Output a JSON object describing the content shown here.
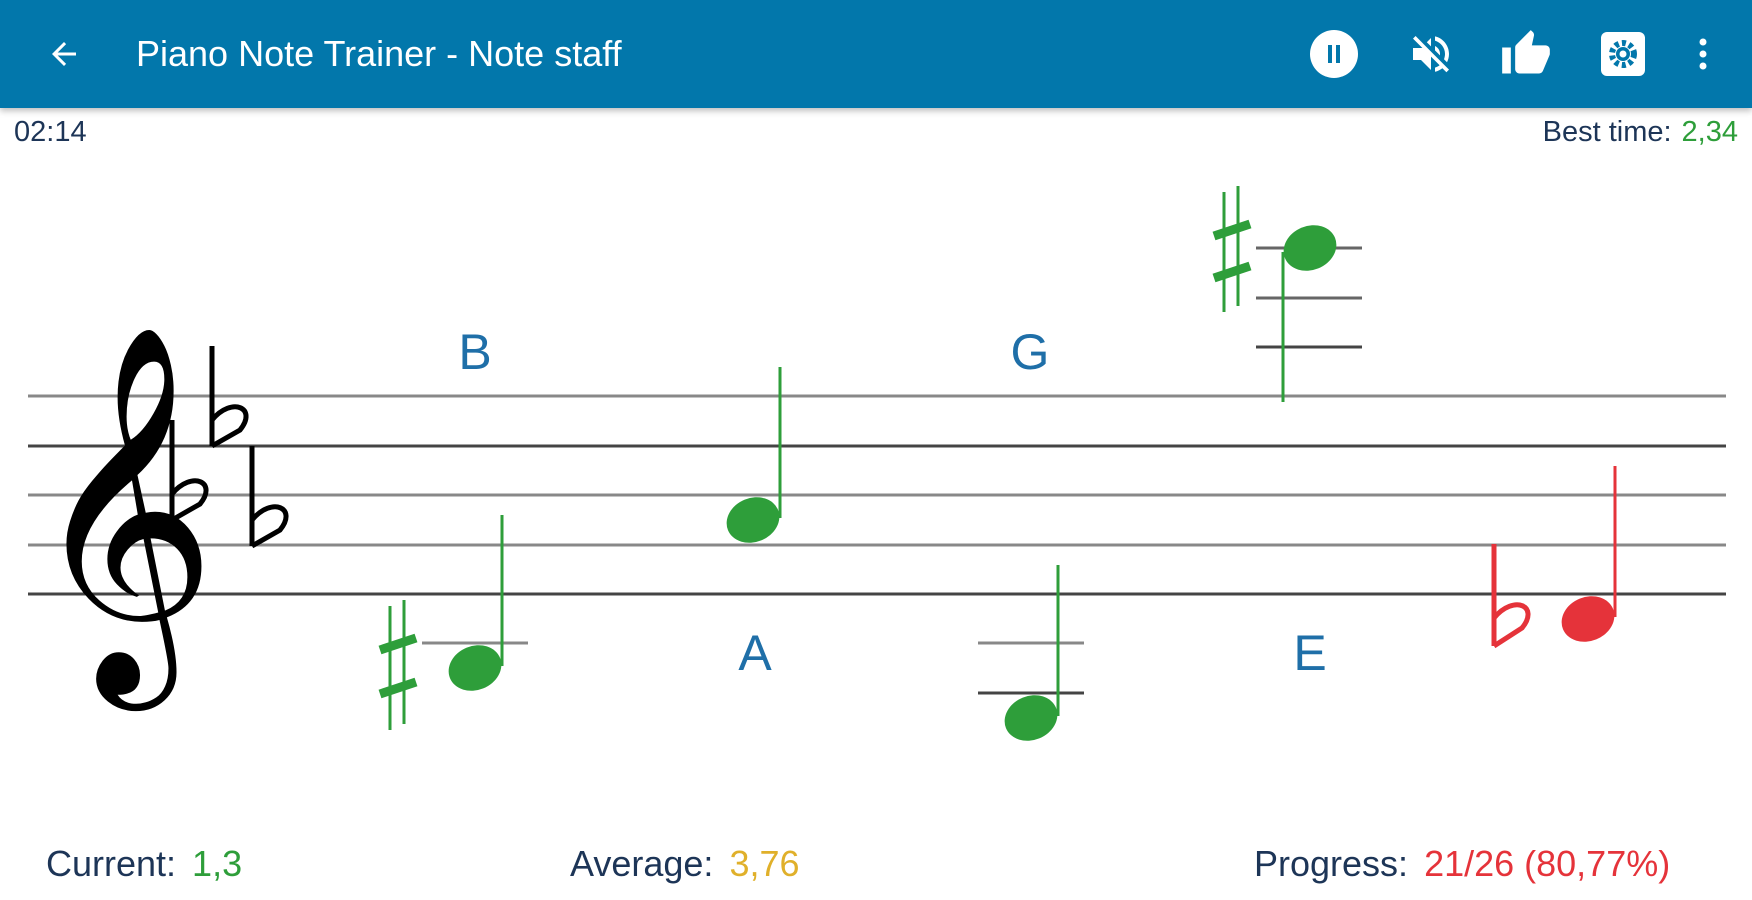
{
  "toolbar": {
    "title": "Piano Note Trainer - Note staff",
    "background": "#0277ab",
    "icons": [
      "back-arrow-icon",
      "pause-icon",
      "sound-off-icon",
      "thumbs-up-icon",
      "settings-icon",
      "overflow-menu-icon"
    ]
  },
  "timer": "02:14",
  "best_time": {
    "label": "Best time:",
    "value": "2,34"
  },
  "staff": {
    "clef": "treble",
    "key_signature": [
      "B-flat",
      "E-flat",
      "A-flat"
    ],
    "notes": [
      {
        "label": "B",
        "accidental": "sharp",
        "status": "correct"
      },
      {
        "label": "A",
        "accidental": "none",
        "status": "correct"
      },
      {
        "label": "G",
        "accidental": "none",
        "status": "correct"
      },
      {
        "label": "E",
        "accidental": "sharp",
        "status": "correct"
      },
      {
        "label": "",
        "accidental": "flat",
        "status": "incorrect"
      }
    ],
    "colors": {
      "correct": "#2e9e3a",
      "incorrect": "#e5333a",
      "label": "#1f6fa8"
    }
  },
  "stats": {
    "current": {
      "label": "Current:",
      "value": "1,3",
      "color": "#2e9e3a"
    },
    "average": {
      "label": "Average:",
      "value": "3,76",
      "color": "#e0b02a"
    },
    "progress": {
      "label": "Progress:",
      "value": "21/26 (80,77%)",
      "color": "#e5333a"
    }
  }
}
